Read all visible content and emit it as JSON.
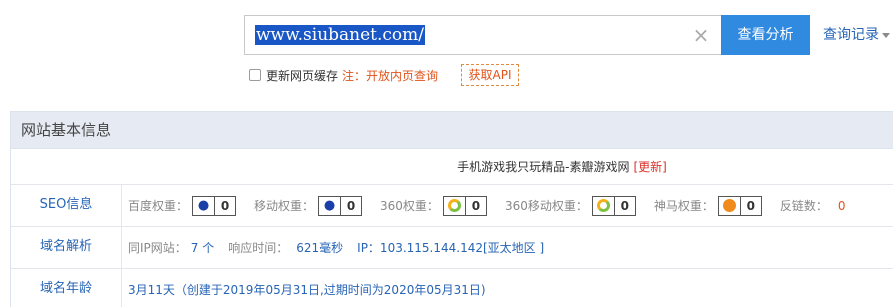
{
  "search": {
    "value": "www.siubanet.com/",
    "clear_icon": "close-icon"
  },
  "buttons": {
    "analyze": "查看分析",
    "history": "查询记录",
    "api": "获取API"
  },
  "cache": {
    "label": "更新网页缓存",
    "note": "注：开放内页查询"
  },
  "panel": {
    "header": "网站基本信息",
    "site_title": "手机游戏我只玩精品-素瓣游戏网",
    "update_label": "[更新]"
  },
  "seo": {
    "label": "SEO信息",
    "ranks": [
      {
        "label": "百度权重：",
        "icon": "baidu-paw-icon",
        "value": "0"
      },
      {
        "label": "移动权重：",
        "icon": "baidu-paw-icon",
        "value": "0"
      },
      {
        "label": "360权重：",
        "icon": "360-ring-icon",
        "value": "0"
      },
      {
        "label": "360移动权重：",
        "icon": "360-ring-icon",
        "value": "0"
      },
      {
        "label": "神马权重：",
        "icon": "shenma-icon",
        "value": "0"
      }
    ],
    "ext_links_label": "反链数：",
    "ext_links_value": "0"
  },
  "domain": {
    "label": "域名解析",
    "same_ip_label": "同IP网站：",
    "same_ip_value": "7 个",
    "response_label": "响应时间：",
    "response_value": "621毫秒",
    "ip_text": "IP：103.115.144.142[亚太地区 ]"
  },
  "age": {
    "label": "域名年龄",
    "text": "3月11天（创建于2019年05月31日,过期时间为2020年05月31日)"
  },
  "colors": {
    "accent": "#2f8ae0",
    "link": "#2764b6",
    "warning": "#e0541c",
    "header_bg": "#e6ebf3"
  }
}
